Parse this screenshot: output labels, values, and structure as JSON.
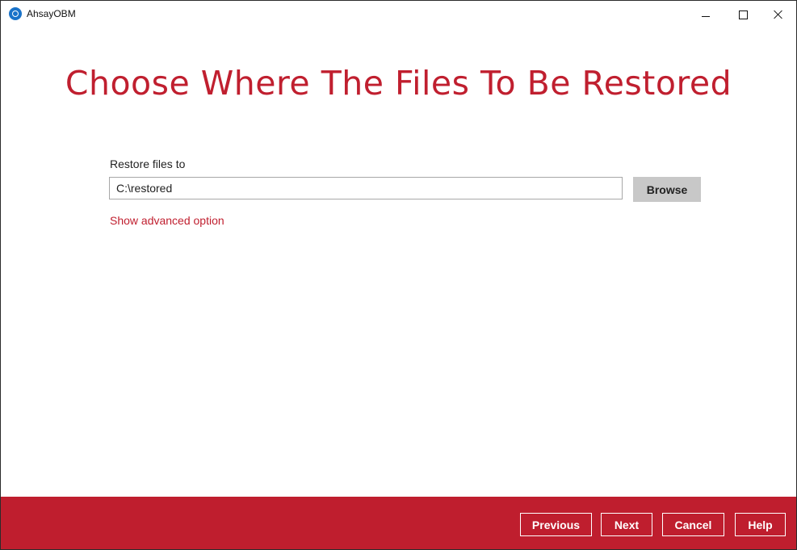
{
  "window": {
    "app_title": "AhsayOBM",
    "logo_icon": "ahsay-logo-icon",
    "controls": [
      "minimize-icon",
      "maximize-icon",
      "close-icon"
    ]
  },
  "page": {
    "title": "Choose Where The Files To Be Restored"
  },
  "restore": {
    "label": "Restore files to",
    "path_value": "C:\\restored",
    "browse_label": "Browse",
    "advanced_link": "Show advanced option"
  },
  "footer": {
    "previous_label": "Previous",
    "next_label": "Next",
    "cancel_label": "Cancel",
    "help_label": "Help"
  },
  "colors": {
    "brand_red": "#bf1e2e",
    "title_red": "#c01f2f",
    "browse_gray": "#c8c8c8"
  }
}
